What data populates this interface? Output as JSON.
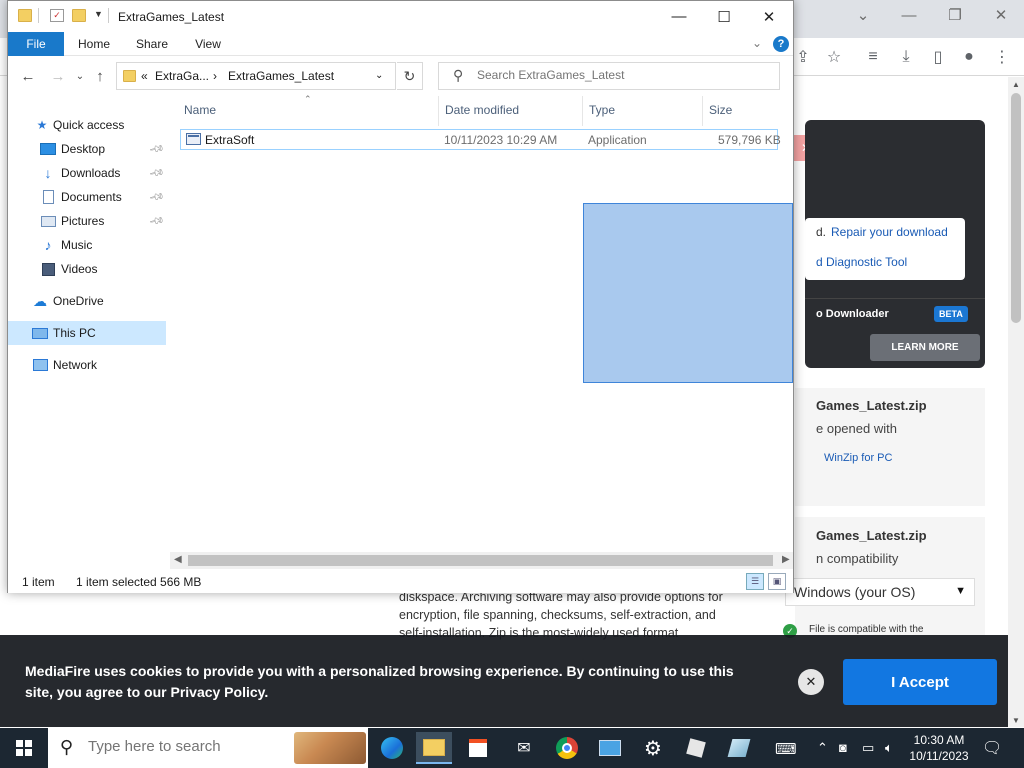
{
  "browser": {
    "article_text": "diskspace. Archiving software may also provide options for encryption, file spanning, checksums, self-extraction, and self-installation. Zip is the most-widely used format"
  },
  "download_panel": {
    "repair_prefix": "d.",
    "repair_link": "Repair your download",
    "diag_link": "d Diagnostic Tool",
    "downloader": "o Downloader",
    "beta": "BETA",
    "learn_more": "LEARN MORE"
  },
  "file_info": {
    "title1": "Games_Latest.zip",
    "sub1": "e opened with",
    "winzip_link": "WinZip for PC",
    "title2": "Games_Latest.zip",
    "sub2": "n compatibility",
    "os_select": "Windows (your OS)",
    "compat_text": "File is compatible with the"
  },
  "cookie": {
    "text": "MediaFire uses cookies to provide you with a personalized browsing experience. By continuing to use this site, you agree to our Privacy Policy.",
    "accept": "I Accept",
    "close": "✕"
  },
  "explorer": {
    "title": "ExtraGames_Latest",
    "ribbon_tabs": [
      "File",
      "Home",
      "Share",
      "View"
    ],
    "breadcrumb": {
      "overflow": "«",
      "parent": "ExtraGa...",
      "sep": "›",
      "current": "ExtraGames_Latest"
    },
    "search_placeholder": "Search ExtraGames_Latest",
    "nav": [
      {
        "label": "Quick access"
      },
      {
        "label": "Desktop"
      },
      {
        "label": "Downloads"
      },
      {
        "label": "Documents"
      },
      {
        "label": "Pictures"
      },
      {
        "label": "Music"
      },
      {
        "label": "Videos"
      },
      {
        "label": "OneDrive"
      },
      {
        "label": "This PC"
      },
      {
        "label": "Network"
      }
    ],
    "columns": [
      "Name",
      "Date modified",
      "Type",
      "Size"
    ],
    "files": [
      {
        "name": "ExtraSoft",
        "date": "10/11/2023 10:29 AM",
        "type": "Application",
        "size": "579,796 KB"
      }
    ],
    "status": {
      "count": "1 item",
      "selected": "1 item selected  566 MB"
    }
  },
  "taskbar": {
    "search_placeholder": "Type here to search",
    "time": "10:30 AM",
    "date": "10/11/2023"
  }
}
